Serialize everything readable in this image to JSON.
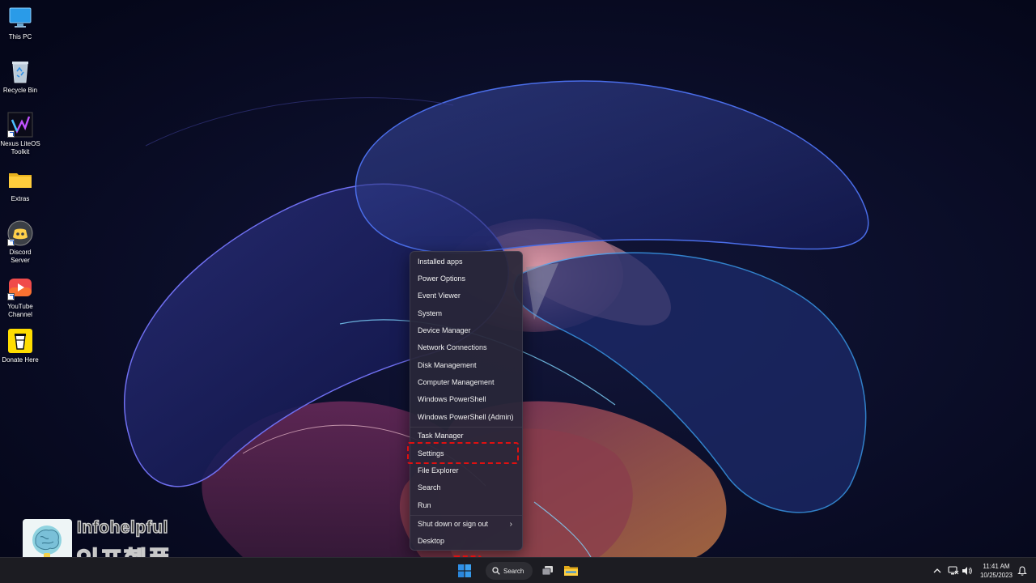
{
  "desktop_icons": [
    {
      "label": "This PC",
      "icon": "monitor-icon"
    },
    {
      "label": "Recycle Bin",
      "icon": "recycle-bin-icon"
    },
    {
      "label": "Nexus LiteOS Toolkit",
      "icon": "nexus-toolkit-icon"
    },
    {
      "label": "Extras",
      "icon": "folder-icon"
    },
    {
      "label": "Discord Server",
      "icon": "discord-icon"
    },
    {
      "label": "YouTube Channel",
      "icon": "youtube-icon"
    },
    {
      "label": "Donate Here",
      "icon": "coffee-cup-icon"
    }
  ],
  "context_menu": {
    "items": [
      {
        "label": "Installed apps"
      },
      {
        "label": "Power Options"
      },
      {
        "label": "Event Viewer"
      },
      {
        "label": "System"
      },
      {
        "label": "Device Manager"
      },
      {
        "label": "Network Connections"
      },
      {
        "label": "Disk Management"
      },
      {
        "label": "Computer Management"
      },
      {
        "label": "Windows PowerShell"
      },
      {
        "label": "Windows PowerShell (Admin)"
      },
      {
        "label": "Task Manager"
      },
      {
        "label": "Settings",
        "highlighted": true
      },
      {
        "label": "File Explorer"
      },
      {
        "label": "Search"
      },
      {
        "label": "Run"
      },
      {
        "label": "Shut down or sign out",
        "submenu": true
      },
      {
        "label": "Desktop"
      }
    ],
    "highlight_color": "#e01010"
  },
  "watermark": {
    "text_en": "Infohelpful",
    "text_ko": "인포헬풀"
  },
  "taskbar": {
    "search_label": "Search",
    "start_icon": "windows-logo-icon",
    "pinned": [
      "task-view-icon",
      "file-explorer-icon"
    ],
    "tray_icons": [
      "chevron-up-icon",
      "network-icon",
      "volume-icon",
      "notification-bell-icon"
    ],
    "clock": {
      "time": "11:41 AM",
      "date": "10/25/2023"
    }
  },
  "colors": {
    "accent_blue": "#2f8fe6",
    "highlight_red": "#e01010"
  }
}
